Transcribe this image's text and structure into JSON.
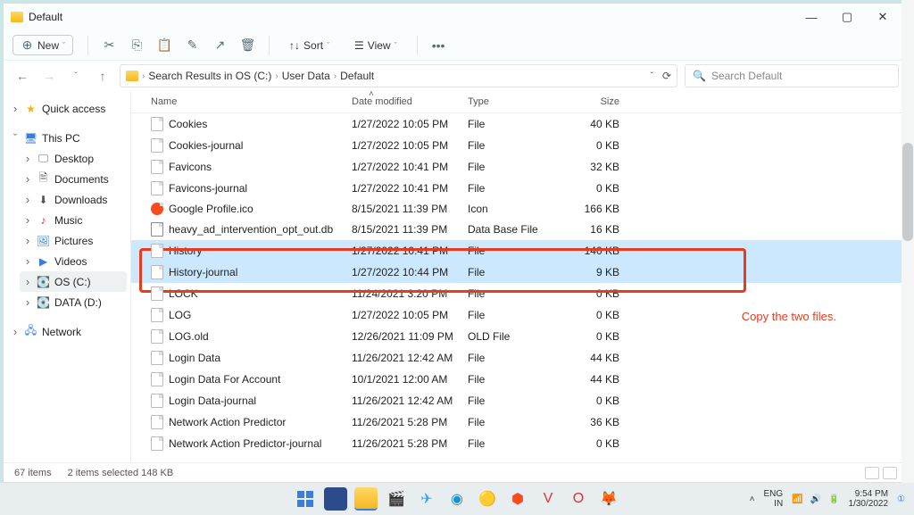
{
  "title": "Default",
  "toolbar": {
    "new": "New",
    "sort": "Sort",
    "view": "View"
  },
  "breadcrumb": {
    "loc": "Search Results in OS (C:)",
    "p1": "User Data",
    "p2": "Default"
  },
  "search": {
    "placeholder": "Search Default"
  },
  "sidebar": {
    "quick": "Quick access",
    "thispc": "This PC",
    "desktop": "Desktop",
    "documents": "Documents",
    "downloads": "Downloads",
    "music": "Music",
    "pictures": "Pictures",
    "videos": "Videos",
    "osc": "OS (C:)",
    "data": "DATA (D:)",
    "network": "Network"
  },
  "columns": {
    "name": "Name",
    "date": "Date modified",
    "type": "Type",
    "size": "Size"
  },
  "files": [
    {
      "name": "Cookies",
      "date": "1/27/2022 10:05 PM",
      "type": "File",
      "size": "40 KB",
      "ico": "file"
    },
    {
      "name": "Cookies-journal",
      "date": "1/27/2022 10:05 PM",
      "type": "File",
      "size": "0 KB",
      "ico": "file"
    },
    {
      "name": "Favicons",
      "date": "1/27/2022 10:41 PM",
      "type": "File",
      "size": "32 KB",
      "ico": "file"
    },
    {
      "name": "Favicons-journal",
      "date": "1/27/2022 10:41 PM",
      "type": "File",
      "size": "0 KB",
      "ico": "file"
    },
    {
      "name": "Google Profile.ico",
      "date": "8/15/2021 11:39 PM",
      "type": "Icon",
      "size": "166 KB",
      "ico": "brave"
    },
    {
      "name": "heavy_ad_intervention_opt_out.db",
      "date": "8/15/2021 11:39 PM",
      "type": "Data Base File",
      "size": "16 KB",
      "ico": "db"
    },
    {
      "name": "History",
      "date": "1/27/2022 10:41 PM",
      "type": "File",
      "size": "140 KB",
      "ico": "file",
      "sel": true
    },
    {
      "name": "History-journal",
      "date": "1/27/2022 10:44 PM",
      "type": "File",
      "size": "9 KB",
      "ico": "file",
      "sel": true
    },
    {
      "name": "LOCK",
      "date": "11/24/2021 3:20 PM",
      "type": "File",
      "size": "0 KB",
      "ico": "file"
    },
    {
      "name": "LOG",
      "date": "1/27/2022 10:05 PM",
      "type": "File",
      "size": "0 KB",
      "ico": "file"
    },
    {
      "name": "LOG.old",
      "date": "12/26/2021 11:09 PM",
      "type": "OLD File",
      "size": "0 KB",
      "ico": "file"
    },
    {
      "name": "Login Data",
      "date": "11/26/2021 12:42 AM",
      "type": "File",
      "size": "44 KB",
      "ico": "file"
    },
    {
      "name": "Login Data For Account",
      "date": "10/1/2021 12:00 AM",
      "type": "File",
      "size": "44 KB",
      "ico": "file"
    },
    {
      "name": "Login Data-journal",
      "date": "11/26/2021 12:42 AM",
      "type": "File",
      "size": "0 KB",
      "ico": "file"
    },
    {
      "name": "Network Action Predictor",
      "date": "11/26/2021 5:28 PM",
      "type": "File",
      "size": "36 KB",
      "ico": "file"
    },
    {
      "name": "Network Action Predictor-journal",
      "date": "11/26/2021 5:28 PM",
      "type": "File",
      "size": "0 KB",
      "ico": "file"
    }
  ],
  "status": {
    "items": "67 items",
    "selected": "2 items selected  148 KB"
  },
  "annotation": "Copy the two files.",
  "taskbar": {
    "lang": "ENG",
    "region": "IN",
    "time": "9:54 PM",
    "date": "1/30/2022"
  }
}
